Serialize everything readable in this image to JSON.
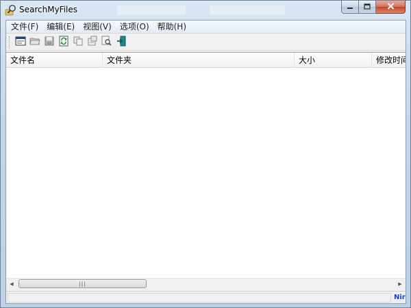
{
  "window": {
    "title": "SearchMyFiles",
    "icons": {
      "app": "magnifier-folder-icon",
      "minimize": "minimize-icon",
      "maximize": "maximize-icon",
      "close": "close-icon"
    },
    "colors": {
      "close_button": "#c4452a",
      "title_bar": "#c4d6ea"
    }
  },
  "menu": {
    "items": [
      "文件(F)",
      "编辑(E)",
      "视图(V)",
      "选项(O)",
      "帮助(H)"
    ]
  },
  "toolbar": {
    "buttons": [
      {
        "icon": "search-options-icon"
      },
      {
        "icon": "open-folder-icon"
      },
      {
        "icon": "save-icon"
      },
      {
        "icon": "refresh-icon"
      },
      {
        "icon": "copy-icon"
      },
      {
        "icon": "properties-icon"
      },
      {
        "icon": "find-icon"
      },
      {
        "icon": "exit-icon"
      }
    ]
  },
  "list": {
    "columns": [
      "文件名",
      "文件夹",
      "大小",
      "修改时间"
    ],
    "rows": []
  },
  "statusbar": {
    "left_text": "",
    "right_text": "Nir"
  }
}
